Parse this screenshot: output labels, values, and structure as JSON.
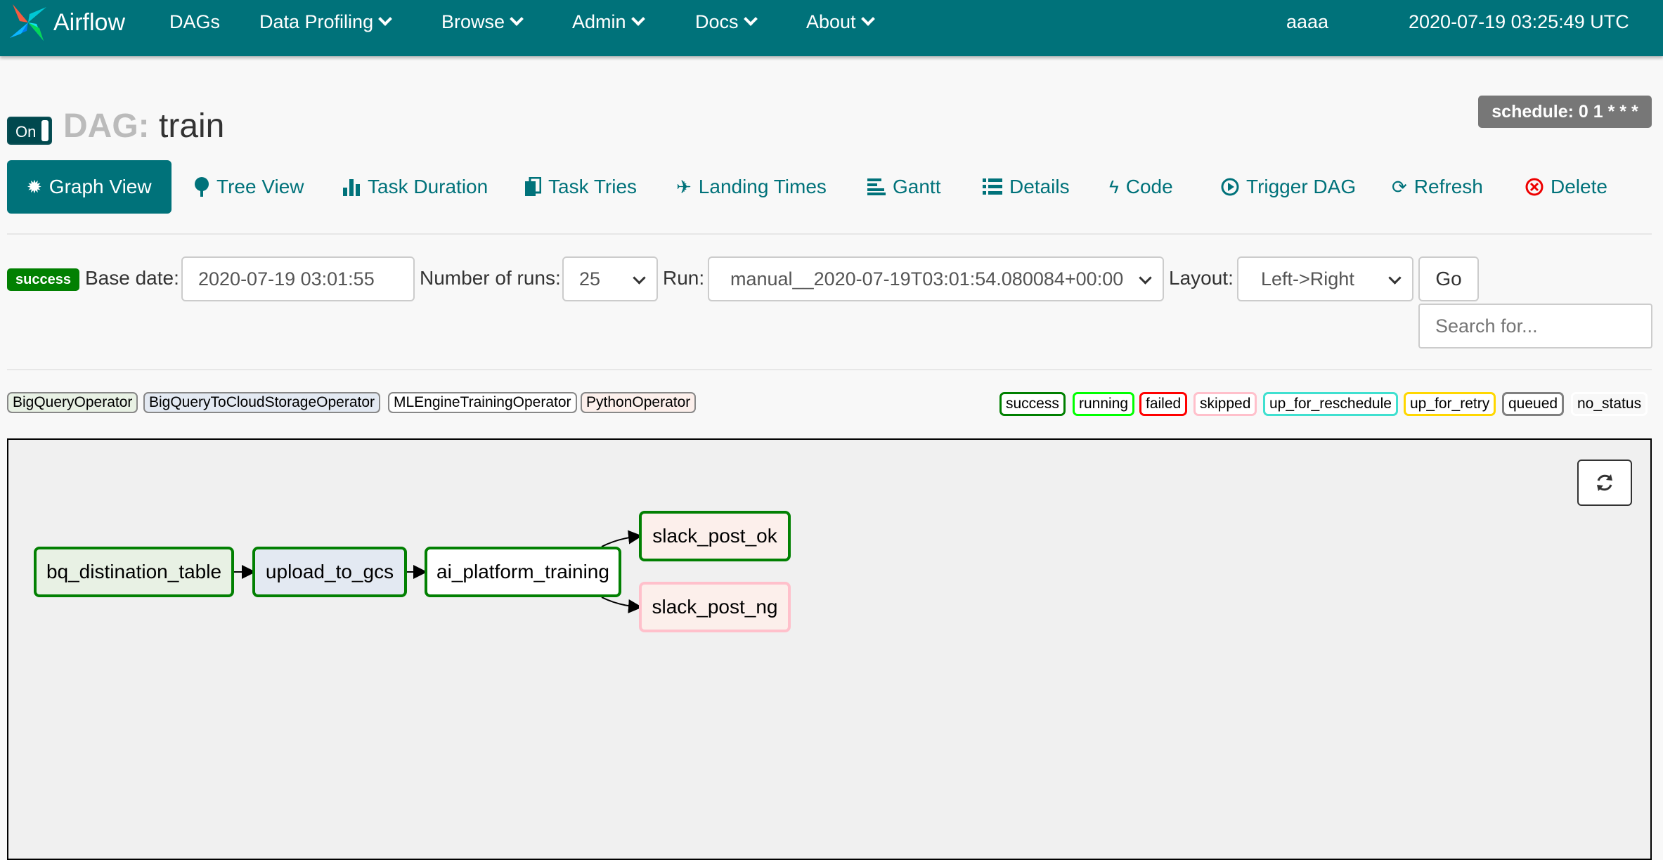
{
  "navbar": {
    "brand": "Airflow",
    "items": [
      {
        "label": "DAGs",
        "dropdown": false
      },
      {
        "label": "Data Profiling",
        "dropdown": true
      },
      {
        "label": "Browse",
        "dropdown": true
      },
      {
        "label": "Admin",
        "dropdown": true
      },
      {
        "label": "Docs",
        "dropdown": true
      },
      {
        "label": "About",
        "dropdown": true
      }
    ],
    "user": "aaaa",
    "time": "2020-07-19 03:25:49 UTC"
  },
  "header": {
    "toggle_label": "On",
    "dag_prefix": "DAG:",
    "dag_name": "train",
    "schedule": "schedule: 0 1 * * *"
  },
  "tabs": [
    {
      "label": "Graph View",
      "icon": "certificate-icon"
    },
    {
      "label": "Tree View",
      "icon": "tree-icon"
    },
    {
      "label": "Task Duration",
      "icon": "bar-chart-icon"
    },
    {
      "label": "Task Tries",
      "icon": "duplicate-icon"
    },
    {
      "label": "Landing Times",
      "icon": "plane-icon"
    },
    {
      "label": "Gantt",
      "icon": "align-left-icon"
    },
    {
      "label": "Details",
      "icon": "list-icon"
    },
    {
      "label": "Code",
      "icon": "flash-icon"
    },
    {
      "label": "Trigger DAG",
      "icon": "play-circle-icon"
    },
    {
      "label": "Refresh",
      "icon": "refresh-icon"
    },
    {
      "label": "Delete",
      "icon": "remove-circle-icon"
    }
  ],
  "form": {
    "status_badge": "success",
    "base_date_label": "Base date:",
    "base_date_value": "2020-07-19 03:01:55",
    "num_runs_label": "Number of runs:",
    "num_runs_value": "25",
    "run_label": "Run:",
    "run_value": "manual__2020-07-19T03:01:54.080084+00:00",
    "layout_label": "Layout:",
    "layout_value": "Left->Right",
    "go_label": "Go",
    "search_placeholder": "Search for..."
  },
  "operators": [
    {
      "label": "BigQueryOperator",
      "color": "#e6f1f2"
    },
    {
      "label": "BigQueryToCloudStorageOperator",
      "color": "#e6f1f2"
    },
    {
      "label": "MLEngineTrainingOperator",
      "color": "#fff"
    },
    {
      "label": "PythonOperator",
      "color": "#ffefeb"
    }
  ],
  "states": [
    {
      "label": "success",
      "color": "#008000"
    },
    {
      "label": "running",
      "color": "#00ff00"
    },
    {
      "label": "failed",
      "color": "#ff0000"
    },
    {
      "label": "skipped",
      "color": "#ffc0cb"
    },
    {
      "label": "up_for_reschedule",
      "color": "#40e0d0"
    },
    {
      "label": "up_for_retry",
      "color": "#ffd700"
    },
    {
      "label": "queued",
      "color": "#808080"
    },
    {
      "label": "no_status",
      "color": "#ffffff"
    }
  ],
  "graph": {
    "nodes": [
      {
        "label": "bq_distination_table",
        "fill": "#e8f1e4",
        "border": "#028002"
      },
      {
        "label": "upload_to_gcs",
        "fill": "#e3e9f2",
        "border": "#028002"
      },
      {
        "label": "ai_platform_training",
        "fill": "#ffffff",
        "border": "#028002"
      },
      {
        "label": "slack_post_ok",
        "fill": "#fcefeb",
        "border": "#028002"
      },
      {
        "label": "slack_post_ng",
        "fill": "#fcefeb",
        "border": "#ffc0cb"
      }
    ]
  }
}
